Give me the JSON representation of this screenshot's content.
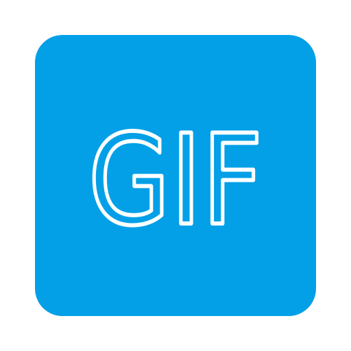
{
  "icon": {
    "label": "GIF",
    "name": "gif-file-icon",
    "colors": {
      "tile": "#03a0e8",
      "text": "#ffffff"
    }
  }
}
